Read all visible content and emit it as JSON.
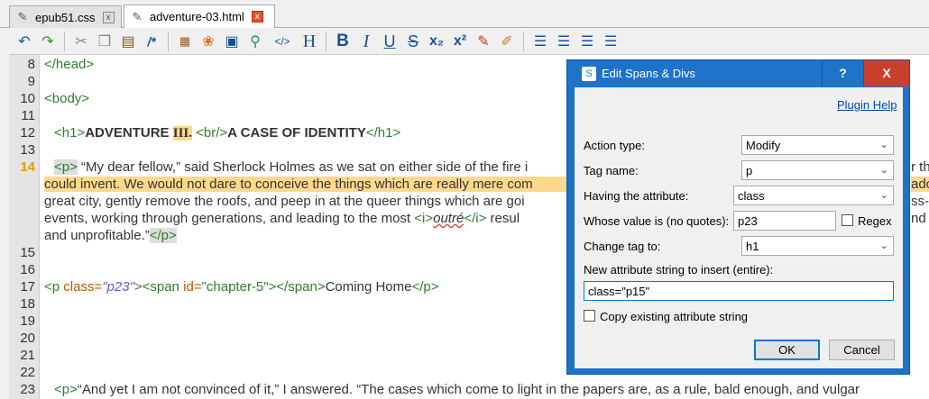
{
  "tabs": [
    {
      "label": "epub51.css",
      "close": "x"
    },
    {
      "label": "adventure-03.html",
      "close": "x"
    }
  ],
  "toolbar": {
    "icons": [
      "undo-icon",
      "redo-icon",
      "cut-icon",
      "copy-icon",
      "paste-icon",
      "comment-icon",
      "insert-image-icon",
      "insert-special-icon",
      "insert-link-icon",
      "insert-id-icon",
      "tag-icon",
      "heading-icon",
      "bold-icon",
      "italic-icon",
      "underline-icon",
      "strikethrough-icon",
      "subscript-icon",
      "superscript-icon",
      "paint-icon",
      "clear-format-icon",
      "align-left-icon",
      "align-center-icon",
      "align-right-icon",
      "justify-icon"
    ],
    "glyphs": {
      "bold": "B",
      "italic": "I",
      "underline": "U",
      "strike": "S",
      "sub": "x₂",
      "sup": "x²",
      "heading": "H",
      "comment": "/*",
      "tag": "</>"
    }
  },
  "editor": {
    "line_numbers": [
      "8",
      "9",
      "10",
      "11",
      "12",
      "13",
      "14",
      "",
      "",
      "",
      "",
      "15",
      "16",
      "17",
      "18",
      "19",
      "20",
      "21",
      "22",
      "23"
    ],
    "current_line": "14",
    "lines": {
      "l8": "</head>",
      "l10": "<body>",
      "l12_open": "<h1>",
      "l12_a": "ADVENTURE ",
      "l12_b": "III.",
      "l12_br": "<br/>",
      "l12_c": "A CASE OF IDENTITY",
      "l12_close": "</h1>",
      "l14_p": "<p>",
      "l14_text": " “My dear fellow,” said Sherlock Holmes as we sat on either side of the fire i",
      "l14_w2a": "could invent. We would not dare to conceive the things which are really mere com",
      "l14_w3": "great city, gently remove the roofs, and peep in at the queer things which are goi",
      "l14_w4a": "events, working through generations, and leading to the most ",
      "l14_i_open": "<i>",
      "l14_outre": "outré",
      "l14_i_close": "</i>",
      "l14_w4b": " resul",
      "l14_w5": "and unprofitable.”",
      "l14_pclose": "</p>",
      "l17_p": "<p ",
      "l17_class": "class=",
      "l17_classval": "\"p23\"",
      "l17_span": "<span ",
      "l17_id": "id=",
      "l17_idval": "\"chapter-5\"",
      "l17_spanclose": "</span>",
      "l17_text": "Coming Home",
      "l17_pclose": "</p>",
      "l23_p": "<p>",
      "l23_text": "“And yet I am not convinced of it,” I answered. “The cases which come to light in the papers are, as a rule, bald enough, and vulgar",
      "right_r1": "r th",
      "right_r2": "ado",
      "right_r3": "ss-",
      "right_r5": "nd"
    }
  },
  "dialog": {
    "title": "Edit Spans & Divs",
    "help_button": "?",
    "close_button": "X",
    "plugin_help": "Plugin Help",
    "action_type_label": "Action type:",
    "action_type_value": "Modify",
    "tag_name_label": "Tag name:",
    "tag_name_value": "p",
    "having_attr_label": "Having the attribute:",
    "having_attr_value": "class",
    "whose_value_label": "Whose value is (no quotes):",
    "whose_value_value": "p23",
    "regex_label": "Regex",
    "change_tag_label": "Change tag to:",
    "change_tag_value": "h1",
    "new_attr_label": "New attribute string to insert (entire):",
    "new_attr_value": "class=\"p15\"",
    "copy_existing_label": "Copy existing attribute string",
    "ok_button": "OK",
    "cancel_button": "Cancel"
  }
}
